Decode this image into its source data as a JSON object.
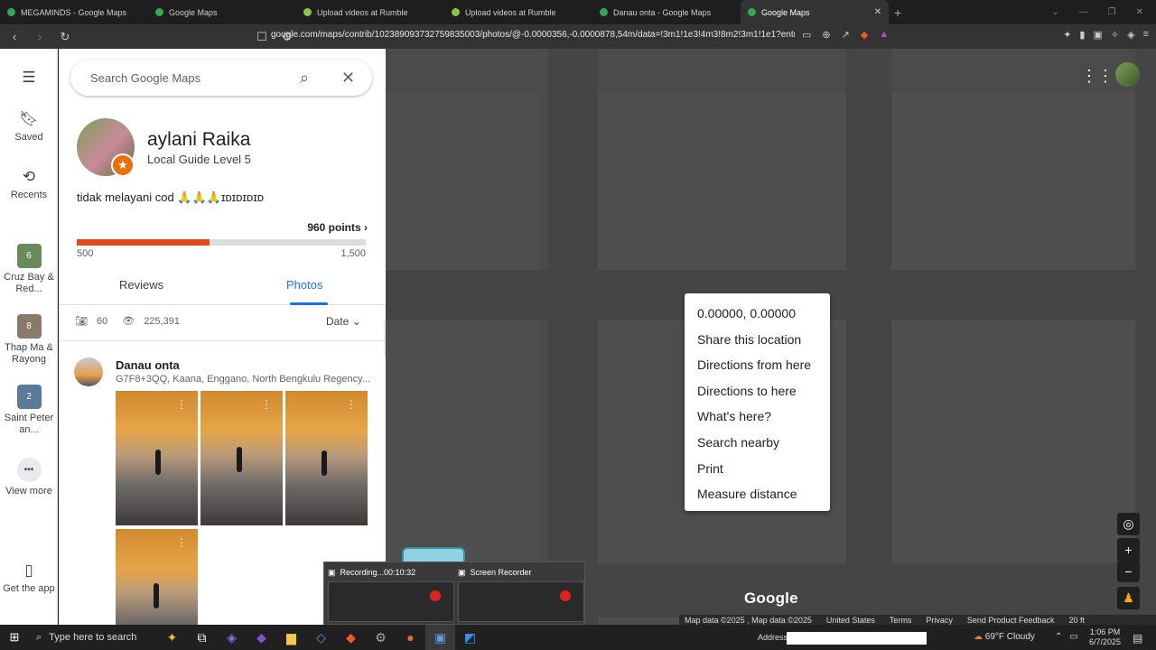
{
  "tabs": [
    {
      "label": "MEGAMINDS - Google Maps",
      "color": "#34a853"
    },
    {
      "label": "Google Maps",
      "color": "#34a853"
    },
    {
      "label": "Upload videos at Rumble",
      "color": "#85c742"
    },
    {
      "label": "Upload videos at Rumble",
      "color": "#85c742"
    },
    {
      "label": "Danau onta - Google Maps",
      "color": "#34a853"
    },
    {
      "label": "Google Maps",
      "color": "#34a853"
    }
  ],
  "browser": {
    "url": "google.com/maps/contrib/102389093732759835003/photos/@-0.0000356,-0.0000878,54m/data=!3m1!1e3!4m3!8m2!3m1!1e1?entry=ttu..."
  },
  "rail": {
    "saved": "Saved",
    "recents": "Recents",
    "recent_items": [
      {
        "label": "Cruz Bay & Red...",
        "count": "6"
      },
      {
        "label": "Thap Ma & Rayong",
        "count": "8"
      },
      {
        "label": "Saint Peter an...",
        "count": "2"
      }
    ],
    "view_more": "View more",
    "get_app": "Get the app"
  },
  "search": {
    "placeholder": "Search Google Maps"
  },
  "profile": {
    "name": "aylani Raika",
    "level": "Local Guide Level 5",
    "bio": "tidak melayani cod 🙏🙏🙏ɪᴅɪᴅɪᴅɪᴅ",
    "points": "960 points ›",
    "progress": 0.46,
    "bar_min": "500",
    "bar_max": "1,500"
  },
  "content_tabs": {
    "reviews": "Reviews",
    "photos": "Photos"
  },
  "stats": {
    "photos": "60",
    "views": "225,391",
    "sort": "Date"
  },
  "place": {
    "name": "Danau onta",
    "address": "G7F8+3QQ, Kaana, Enggano, North Bengkulu Regency..."
  },
  "context_menu": [
    "0.00000, 0.00000",
    "Share this location",
    "Directions from here",
    "Directions to here",
    "What's here?",
    "Search nearby",
    "Print",
    "Measure distance"
  ],
  "map": {
    "logo": "Google",
    "attribution": [
      "Map data ©2025 , Map data ©2025",
      "United States",
      "Terms",
      "Privacy",
      "Send Product Feedback",
      "20 ft"
    ]
  },
  "preview": {
    "win1": "Recording...00:10:32",
    "win2": "Screen Recorder"
  },
  "taskbar": {
    "search": "Type here to search",
    "address_label": "Address",
    "weather": "69°F  Cloudy",
    "time": "1:06 PM",
    "date": "6/7/2025"
  }
}
